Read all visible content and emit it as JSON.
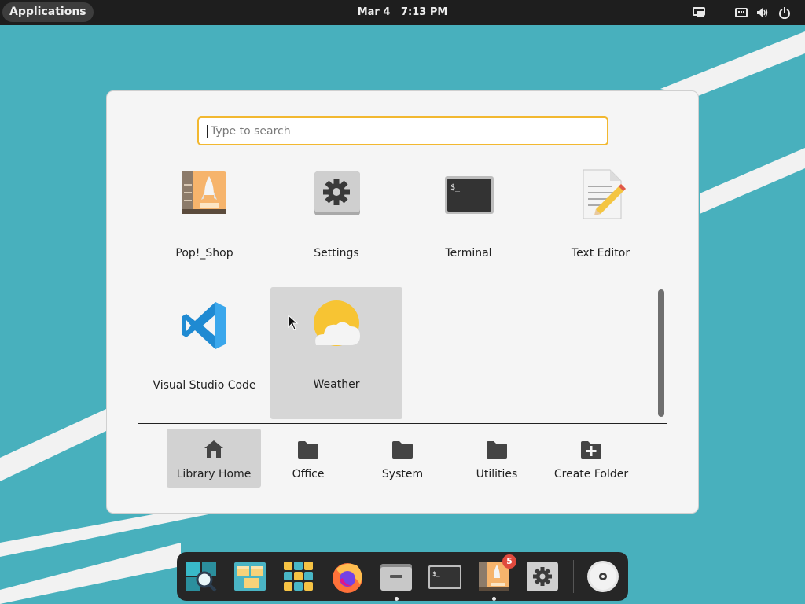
{
  "top_panel": {
    "applications_label": "Applications",
    "date": "Mar 4",
    "time": "7:13 PM"
  },
  "launcher": {
    "search": {
      "value": "",
      "placeholder": "Type to search"
    },
    "apps": [
      {
        "label": "Pop!_Shop",
        "icon": "pop-shop-icon"
      },
      {
        "label": "Settings",
        "icon": "settings-gear-icon"
      },
      {
        "label": "Terminal",
        "icon": "terminal-icon",
        "prompt_text": "$_"
      },
      {
        "label": "Text Editor",
        "icon": "text-editor-icon"
      },
      {
        "label": "Visual Studio Code",
        "icon": "vscode-icon"
      },
      {
        "label": "Weather",
        "icon": "weather-icon",
        "selected": true
      }
    ],
    "folders": [
      {
        "label": "Library Home",
        "icon": "home-icon",
        "selected": true
      },
      {
        "label": "Office",
        "icon": "folder-icon"
      },
      {
        "label": "System",
        "icon": "folder-icon"
      },
      {
        "label": "Utilities",
        "icon": "folder-icon"
      },
      {
        "label": "Create Folder",
        "icon": "folder-add-icon"
      }
    ]
  },
  "dock": {
    "items": [
      {
        "name": "launcher-search",
        "icon": "search-launcher-icon"
      },
      {
        "name": "workspaces",
        "icon": "workspaces-icon"
      },
      {
        "name": "app-grid",
        "icon": "app-grid-icon"
      },
      {
        "name": "firefox",
        "icon": "firefox-icon"
      },
      {
        "name": "files",
        "icon": "files-icon",
        "running": true
      },
      {
        "name": "terminal",
        "icon": "terminal-icon",
        "prompt_text": "$_"
      },
      {
        "name": "pop-shop",
        "icon": "pop-shop-icon",
        "running": true,
        "badge": "5"
      },
      {
        "name": "settings",
        "icon": "settings-gear-icon"
      },
      {
        "name": "optical-disc",
        "icon": "disc-icon"
      }
    ]
  },
  "colors": {
    "wallpaper": "#48b0bd",
    "panel": "#1e1e1e",
    "search_focus": "#f2b830",
    "badge": "#e04a3e"
  }
}
